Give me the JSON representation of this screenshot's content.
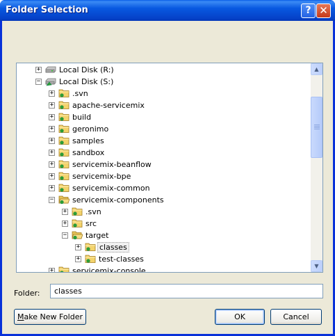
{
  "dialog": {
    "title": "Folder Selection",
    "help_label": "?",
    "close_label": "✕"
  },
  "tree": {
    "rows": [
      {
        "label": "Local Disk (R:)",
        "expander": "+",
        "icon": "drive-icon",
        "depth": 1
      },
      {
        "label": "Local Disk (S:)",
        "expander": "−",
        "icon": "shared-drive-icon",
        "depth": 1
      },
      {
        "label": ".svn",
        "expander": "+",
        "icon": "folder-icon",
        "depth": 2
      },
      {
        "label": "apache-servicemix",
        "expander": "+",
        "icon": "folder-icon",
        "depth": 2
      },
      {
        "label": "build",
        "expander": "+",
        "icon": "folder-icon",
        "depth": 2
      },
      {
        "label": "geronimo",
        "expander": "+",
        "icon": "folder-icon",
        "depth": 2
      },
      {
        "label": "samples",
        "expander": "+",
        "icon": "folder-icon",
        "depth": 2
      },
      {
        "label": "sandbox",
        "expander": "+",
        "icon": "folder-icon",
        "depth": 2
      },
      {
        "label": "servicemix-beanflow",
        "expander": "+",
        "icon": "folder-icon",
        "depth": 2
      },
      {
        "label": "servicemix-bpe",
        "expander": "+",
        "icon": "folder-icon",
        "depth": 2
      },
      {
        "label": "servicemix-common",
        "expander": "+",
        "icon": "folder-icon",
        "depth": 2
      },
      {
        "label": "servicemix-components",
        "expander": "−",
        "icon": "open-folder-icon",
        "depth": 2
      },
      {
        "label": ".svn",
        "expander": "+",
        "icon": "folder-icon",
        "depth": 3
      },
      {
        "label": "src",
        "expander": "+",
        "icon": "folder-icon",
        "depth": 3
      },
      {
        "label": "target",
        "expander": "−",
        "icon": "open-folder-icon",
        "depth": 3
      },
      {
        "label": "classes",
        "expander": "+",
        "icon": "folder-icon",
        "depth": 4,
        "selected": true
      },
      {
        "label": "test-classes",
        "expander": "+",
        "icon": "folder-icon",
        "depth": 4
      },
      {
        "label": "servicemix-console",
        "expander": "+",
        "icon": "folder-icon",
        "depth": 2
      }
    ]
  },
  "scroll": {
    "up": "▲",
    "down": "▼"
  },
  "folder": {
    "label": "Folder:",
    "value": "classes"
  },
  "buttons": {
    "make_new_folder_u": "M",
    "make_new_folder_rest": "ake New Folder",
    "ok": "OK",
    "cancel": "Cancel"
  },
  "colors": {
    "title_bar": "#0554d6",
    "selection_bg": "#f0f0f0",
    "folder_yellow": "#f3d36c",
    "svn_green": "#2fa02f"
  }
}
